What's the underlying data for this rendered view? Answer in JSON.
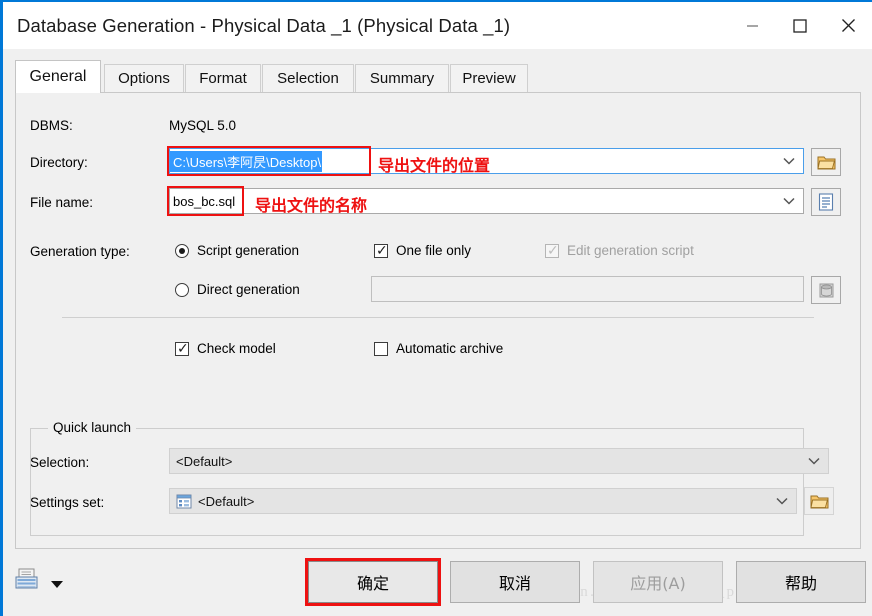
{
  "window": {
    "title": "Database Generation - Physical Data _1 (Physical Data _1)",
    "minimize_label": "–",
    "maximize_label": "□",
    "close_label": "✕"
  },
  "tabs": [
    {
      "label": "General",
      "active": true
    },
    {
      "label": "Options",
      "active": false
    },
    {
      "label": "Format",
      "active": false
    },
    {
      "label": "Selection",
      "active": false
    },
    {
      "label": "Summary",
      "active": false
    },
    {
      "label": "Preview",
      "active": false
    }
  ],
  "general": {
    "dbms_label": "DBMS:",
    "dbms_value": "MySQL 5.0",
    "directory_label": "Directory:",
    "directory_value": "C:\\Users\\李阿昃\\Desktop\\",
    "directory_annotation": "导出文件的位置",
    "filename_label": "File name:",
    "filename_value": "bos_bc.sql",
    "filename_annotation": "导出文件的名称",
    "generation_type_label": "Generation type:",
    "script_generation_label": "Script generation",
    "script_generation_checked": true,
    "direct_generation_label": "Direct generation",
    "direct_generation_checked": false,
    "one_file_only_label": "One file only",
    "one_file_only_checked": true,
    "edit_generation_script_label": "Edit generation script",
    "edit_generation_script_checked": true,
    "edit_generation_script_disabled": true,
    "direct_connection_value": "",
    "check_model_label": "Check model",
    "check_model_checked": true,
    "automatic_archive_label": "Automatic archive",
    "automatic_archive_checked": false
  },
  "quick_launch": {
    "group_title": "Quick launch",
    "selection_label": "Selection:",
    "selection_value": "<Default>",
    "settings_set_label": "Settings set:",
    "settings_set_value": "<Default>"
  },
  "buttons": {
    "ok": "确定",
    "cancel": "取消",
    "apply": "应用(A)",
    "apply_disabled": true,
    "help": "帮助"
  },
  "icons": {
    "folder": "folder-icon",
    "document": "document-icon",
    "database": "database-icon",
    "settings_set": "settings-set-icon",
    "print": "print-icon",
    "dropdown_arrow": "chevron-down-icon"
  },
  "watermark": "http://blog.csdn.net/weronyuan_pku",
  "colors": {
    "accent": "#0078d7",
    "annotation_red": "#ee1111",
    "selection_blue": "#3399ff",
    "dialog_bg": "#f0f0f0"
  }
}
